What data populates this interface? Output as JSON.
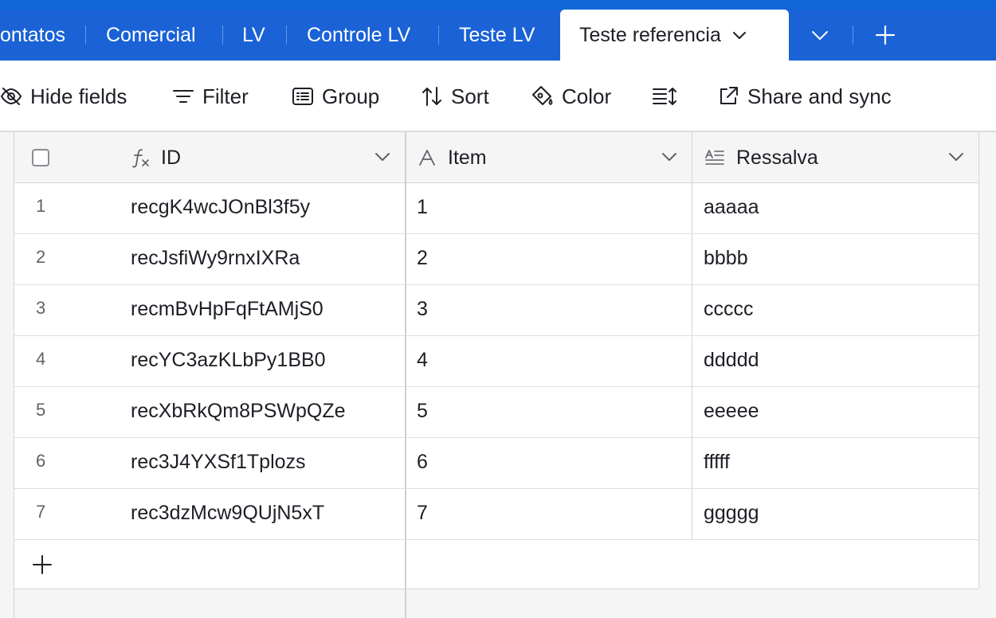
{
  "tabs": [
    {
      "label": "ontatos"
    },
    {
      "label": "Comercial"
    },
    {
      "label": "LV"
    },
    {
      "label": "Controle LV"
    },
    {
      "label": "Teste LV"
    },
    {
      "label": "Teste referencia",
      "active": true
    }
  ],
  "toolbar": {
    "hide_fields": "Hide fields",
    "filter": "Filter",
    "group": "Group",
    "sort": "Sort",
    "color": "Color",
    "share": "Share and sync"
  },
  "grid": {
    "columns": [
      {
        "label": "ID",
        "icon": "formula-icon"
      },
      {
        "label": "Item",
        "icon": "text-a-icon"
      },
      {
        "label": "Ressalva",
        "icon": "long-text-icon"
      }
    ],
    "rows": [
      {
        "num": "1",
        "id": "recgK4wcJOnBl3f5y",
        "item": "1",
        "ressalva": "aaaaa"
      },
      {
        "num": "2",
        "id": "recJsfiWy9rnxIXRa",
        "item": "2",
        "ressalva": "bbbb"
      },
      {
        "num": "3",
        "id": "recmBvHpFqFtAMjS0",
        "item": "3",
        "ressalva": "ccccc"
      },
      {
        "num": "4",
        "id": "recYC3azKLbPy1BB0",
        "item": "4",
        "ressalva": "ddddd"
      },
      {
        "num": "5",
        "id": "recXbRkQm8PSWpQZe",
        "item": "5",
        "ressalva": "eeeee"
      },
      {
        "num": "6",
        "id": "rec3J4YXSf1Tplozs",
        "item": "6",
        "ressalva": "fffff"
      },
      {
        "num": "7",
        "id": "rec3dzMcw9QUjN5xT",
        "item": "7",
        "ressalva": "ggggg"
      }
    ]
  },
  "colors": {
    "tabbar": "#1a62d6",
    "grid_bg": "#f5f5f5",
    "border": "#d4d4d4"
  }
}
